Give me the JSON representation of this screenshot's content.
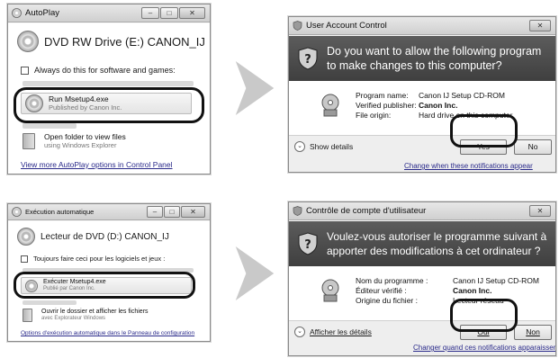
{
  "step_en": {
    "autoplay": {
      "title": "AutoPlay",
      "drive": "DVD RW Drive (E:) CANON_IJ",
      "always_do": "Always do this for software and games:",
      "run_item": {
        "title": "Run Msetup4.exe",
        "subtitle": "Published by Canon Inc."
      },
      "folder_item": {
        "title": "Open folder to view files",
        "subtitle": "using Windows Explorer"
      },
      "more_link": "View more AutoPlay options in Control Panel"
    },
    "uac": {
      "title": "User Account Control",
      "question": "Do you want to allow the following program to make changes to this computer?",
      "fields": [
        {
          "key": "Program name:",
          "value": "Canon IJ Setup CD-ROM"
        },
        {
          "key": "Verified publisher:",
          "value": "Canon Inc."
        },
        {
          "key": "File origin:",
          "value": "Hard drive on this computer"
        }
      ],
      "show_details": "Show details",
      "yes": "Yes",
      "no": "No",
      "change_link": "Change when these notifications appear"
    }
  },
  "step_fr": {
    "autoplay": {
      "title": "Exécution automatique",
      "drive": "Lecteur de DVD (D:) CANON_IJ",
      "always_do": "Toujours faire ceci pour les logiciels et jeux :",
      "run_item": {
        "title": "Exécuter Msetup4.exe",
        "subtitle": "Publié par Canon Inc."
      },
      "folder_item": {
        "title": "Ouvrir le dossier et afficher les fichiers",
        "subtitle": "avec Explorateur Windows"
      },
      "more_link": "Options d'exécution automatique dans le Panneau de configuration"
    },
    "uac": {
      "title": "Contrôle de compte d'utilisateur",
      "question": "Voulez-vous autoriser le programme suivant à apporter des modifications à cet ordinateur ?",
      "fields": [
        {
          "key": "Nom du programme :",
          "value": "Canon IJ Setup CD-ROM"
        },
        {
          "key": "Éditeur vérifié :",
          "value": "Canon Inc."
        },
        {
          "key": "Origine du fichier :",
          "value": "Lecteur réseau"
        }
      ],
      "show_details": "Afficher les détails",
      "yes": "Oui",
      "no": "Non",
      "change_link": "Changer quand ces notifications apparaissent"
    }
  },
  "window_controls": {
    "minimize": "–",
    "maximize": "□",
    "close": "✕"
  },
  "icons": [
    "autoplay-icon",
    "disc-icon",
    "folder-icon",
    "shield-icon",
    "setup-program-icon",
    "chevron-down-icon",
    "right-arrow-icon"
  ]
}
